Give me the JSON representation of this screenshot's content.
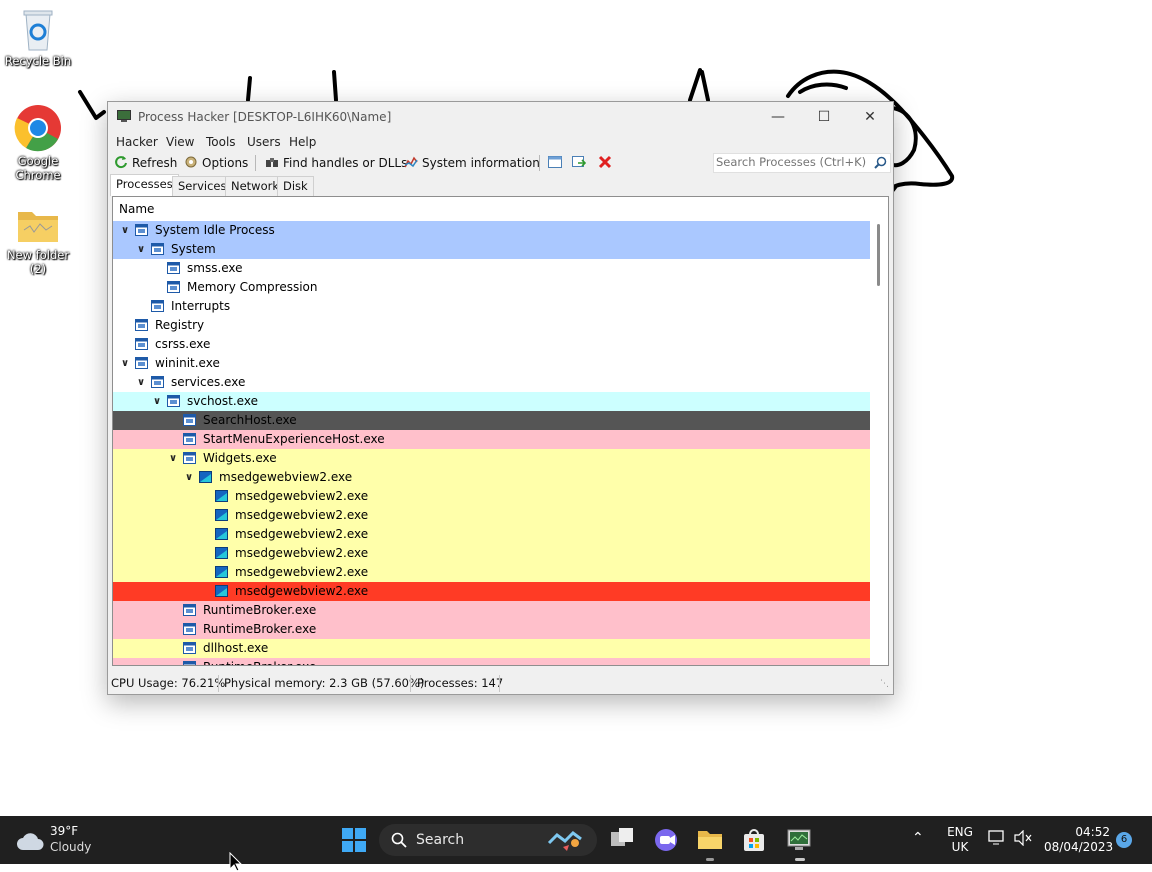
{
  "desktop": {
    "icons": [
      {
        "label": "Recycle Bin",
        "icon": "recycle-bin-icon"
      },
      {
        "label": "Google Chrome",
        "icon": "chrome-icon"
      },
      {
        "label": "New folder (2)",
        "icon": "folder-icon"
      }
    ]
  },
  "window": {
    "title": "Process Hacker [DESKTOP-L6IHK60\\Name]",
    "menu": [
      "Hacker",
      "View",
      "Tools",
      "Users",
      "Help"
    ],
    "toolbar": {
      "refresh": "Refresh",
      "options": "Options",
      "find_handles": "Find handles or DLLs",
      "system_information": "System information",
      "search_placeholder": "Search Processes (Ctrl+K)"
    },
    "tabs": [
      "Processes",
      "Services",
      "Network",
      "Disk"
    ],
    "active_tab": "Processes",
    "column_header": "Name",
    "processes": [
      {
        "name": "System Idle Process",
        "depth": 0,
        "expanded": true,
        "bg": "#aac8ff",
        "fg": "#000000",
        "icon": "window"
      },
      {
        "name": "System",
        "depth": 1,
        "expanded": true,
        "bg": "#aac8ff",
        "fg": "#000000",
        "icon": "window"
      },
      {
        "name": "smss.exe",
        "depth": 2,
        "expanded": null,
        "bg": "#ffffff",
        "fg": "#000000",
        "icon": "window"
      },
      {
        "name": "Memory Compression",
        "depth": 2,
        "expanded": null,
        "bg": "#ffffff",
        "fg": "#000000",
        "icon": "window"
      },
      {
        "name": "Interrupts",
        "depth": 1,
        "expanded": null,
        "bg": "#ffffff",
        "fg": "#000000",
        "icon": "window"
      },
      {
        "name": "Registry",
        "depth": 0,
        "expanded": null,
        "bg": "#ffffff",
        "fg": "#000000",
        "icon": "window"
      },
      {
        "name": "csrss.exe",
        "depth": 0,
        "expanded": null,
        "bg": "#ffffff",
        "fg": "#000000",
        "icon": "window"
      },
      {
        "name": "wininit.exe",
        "depth": 0,
        "expanded": true,
        "bg": "#ffffff",
        "fg": "#000000",
        "icon": "window"
      },
      {
        "name": "services.exe",
        "depth": 1,
        "expanded": true,
        "bg": "#ffffff",
        "fg": "#000000",
        "icon": "window"
      },
      {
        "name": "svchost.exe",
        "depth": 2,
        "expanded": true,
        "bg": "#ccffff",
        "fg": "#000000",
        "icon": "window"
      },
      {
        "name": "SearchHost.exe",
        "depth": 3,
        "expanded": null,
        "bg": "#555555",
        "fg": "#000000",
        "icon": "window"
      },
      {
        "name": "StartMenuExperienceHost.exe",
        "depth": 3,
        "expanded": null,
        "bg": "#ffc0cb",
        "fg": "#000000",
        "icon": "window"
      },
      {
        "name": "Widgets.exe",
        "depth": 3,
        "expanded": true,
        "bg": "#ffffaa",
        "fg": "#000000",
        "icon": "window"
      },
      {
        "name": "msedgewebview2.exe",
        "depth": 4,
        "expanded": true,
        "bg": "#ffffaa",
        "fg": "#000000",
        "icon": "edge"
      },
      {
        "name": "msedgewebview2.exe",
        "depth": 5,
        "expanded": null,
        "bg": "#ffffaa",
        "fg": "#000000",
        "icon": "edge"
      },
      {
        "name": "msedgewebview2.exe",
        "depth": 5,
        "expanded": null,
        "bg": "#ffffaa",
        "fg": "#000000",
        "icon": "edge"
      },
      {
        "name": "msedgewebview2.exe",
        "depth": 5,
        "expanded": null,
        "bg": "#ffffaa",
        "fg": "#000000",
        "icon": "edge"
      },
      {
        "name": "msedgewebview2.exe",
        "depth": 5,
        "expanded": null,
        "bg": "#ffffaa",
        "fg": "#000000",
        "icon": "edge"
      },
      {
        "name": "msedgewebview2.exe",
        "depth": 5,
        "expanded": null,
        "bg": "#ffffaa",
        "fg": "#000000",
        "icon": "edge"
      },
      {
        "name": "msedgewebview2.exe",
        "depth": 5,
        "expanded": null,
        "bg": "#ff3b25",
        "fg": "#000000",
        "icon": "edge"
      },
      {
        "name": "RuntimeBroker.exe",
        "depth": 3,
        "expanded": null,
        "bg": "#ffc0cb",
        "fg": "#000000",
        "icon": "window"
      },
      {
        "name": "RuntimeBroker.exe",
        "depth": 3,
        "expanded": null,
        "bg": "#ffc0cb",
        "fg": "#000000",
        "icon": "window"
      },
      {
        "name": "dllhost.exe",
        "depth": 3,
        "expanded": null,
        "bg": "#ffffaa",
        "fg": "#000000",
        "icon": "window"
      },
      {
        "name": "RuntimeBroker.exe",
        "depth": 3,
        "expanded": null,
        "bg": "#ffc0cb",
        "fg": "#000000",
        "icon": "window"
      }
    ],
    "status": {
      "cpu": "CPU Usage: 76.21%",
      "memory": "Physical memory: 2.3 GB (57.60%)",
      "processes": "Processes: 147"
    }
  },
  "taskbar": {
    "weather_temp": "39°F",
    "weather_desc": "Cloudy",
    "search_label": "Search",
    "lang_top": "ENG",
    "lang_bottom": "UK",
    "time": "04:52",
    "date": "08/04/2023",
    "notification_count": "6"
  }
}
